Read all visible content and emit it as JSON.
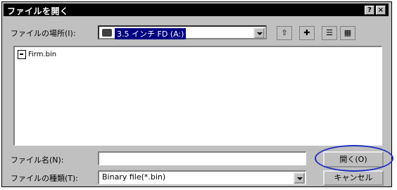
{
  "window": {
    "title": "ファイルを開く",
    "help_label": "?",
    "close_label": "×"
  },
  "look_in": {
    "label": "ファイルの場所(I):",
    "value": "3.5 インチ FD (A:)"
  },
  "toolbar": {
    "up_folder_icon": "up-folder-icon",
    "new_folder_icon": "new-folder-icon",
    "list_view_icon": "list-view-icon",
    "details_view_icon": "details-view-icon"
  },
  "files": [
    {
      "name": "Firm.bin"
    }
  ],
  "file_name": {
    "label": "ファイル名(N):",
    "value": ""
  },
  "file_type": {
    "label": "ファイルの種類(T):",
    "value": "Binary file(*.bin)"
  },
  "buttons": {
    "open": "開く(O)",
    "cancel": "キャンセル"
  },
  "colors": {
    "titlebar": "#000000",
    "dialog": "#c0c0c0",
    "highlight": "#2030c0"
  }
}
